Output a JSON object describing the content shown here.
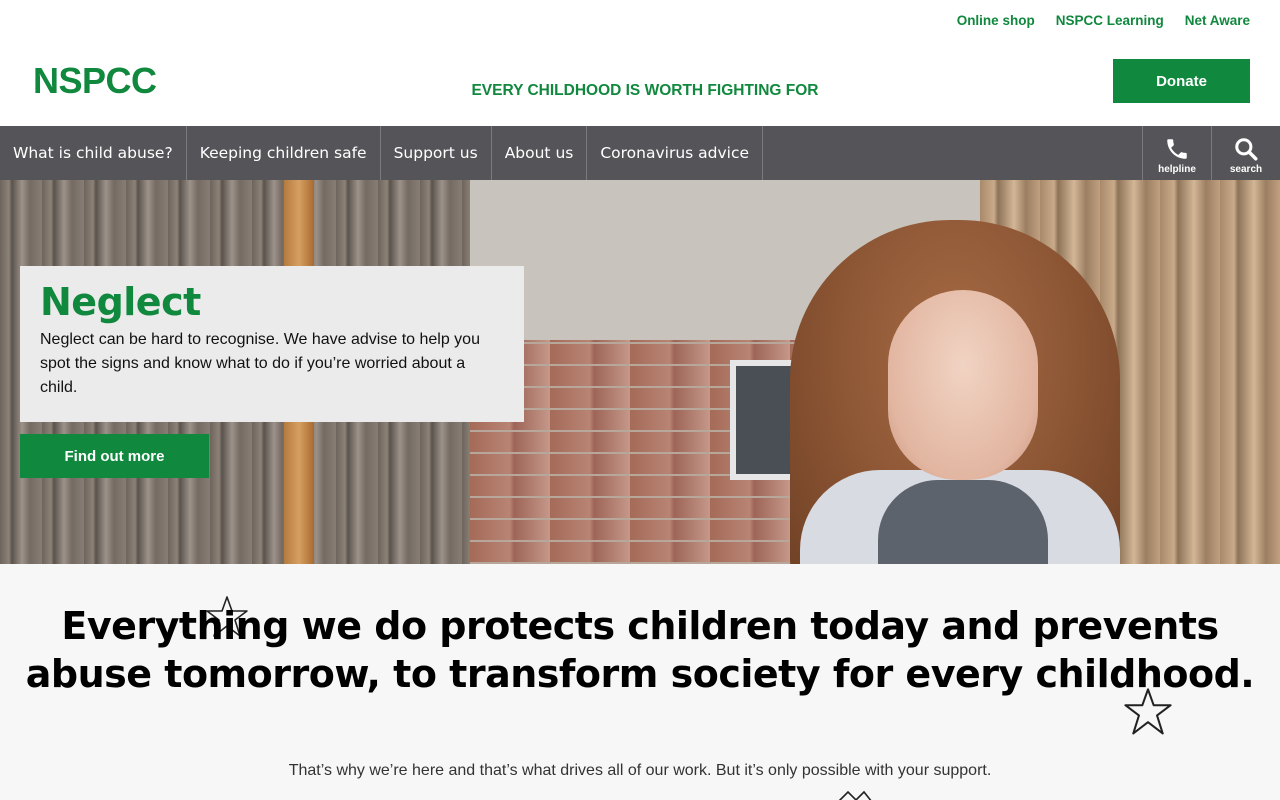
{
  "utility_nav": {
    "links": [
      "Online shop",
      "NSPCC Learning",
      "Net Aware"
    ]
  },
  "header": {
    "logo": "NSPCC",
    "tagline": "EVERY CHILDHOOD IS WORTH FIGHTING FOR",
    "donate_label": "Donate"
  },
  "main_nav": {
    "items": [
      "What is child abuse?",
      "Keeping children safe",
      "Support us",
      "About us",
      "Coronavirus advice"
    ],
    "helpline_label": "helpline",
    "search_label": "search"
  },
  "hero": {
    "title": "Neglect",
    "body": "Neglect can be hard to recognise. We have advise to help you spot the signs and know what to do if you’re worried about a child.",
    "cta_label": "Find out more"
  },
  "mission": {
    "heading": "Everything we do protects children today and prevents abuse tomorrow, to transform society for every childhood.",
    "subtext": "That’s why we’re here and that’s what drives all of our work. But it’s only possible with your support."
  },
  "colors": {
    "brand_green": "#10883d",
    "nav_grey": "#555559",
    "card_grey": "#ebebeb"
  },
  "icons": [
    "phone-icon",
    "search-icon",
    "star-doodle-icon"
  ]
}
